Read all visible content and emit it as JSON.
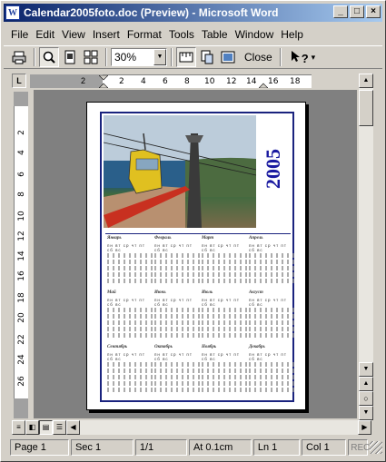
{
  "window": {
    "title": "Calendar2005foto.doc (Preview) - Microsoft Word",
    "app_icon": "W"
  },
  "title_buttons": {
    "minimize": "_",
    "maximize": "□",
    "close": "×"
  },
  "menu": [
    "File",
    "Edit",
    "View",
    "Insert",
    "Format",
    "Tools",
    "Table",
    "Window",
    "Help"
  ],
  "toolbar": {
    "zoom": "30%",
    "close_label": "Close",
    "help_label": "?"
  },
  "ruler": {
    "corner": "L",
    "h_ticks": [
      "2",
      "4",
      "6",
      "8",
      "10",
      "12",
      "14",
      "16",
      "18"
    ],
    "h_neg": "2",
    "v_ticks": [
      "2",
      "4",
      "6",
      "8",
      "10",
      "12",
      "14",
      "16",
      "18",
      "20",
      "22",
      "24",
      "26"
    ]
  },
  "document": {
    "year": "2005",
    "months": [
      "Январь",
      "Февраль",
      "Март",
      "Апрель",
      "Май",
      "Июнь",
      "Июль",
      "Август",
      "Сентябрь",
      "Октябрь",
      "Ноябрь",
      "Декабрь"
    ],
    "weekdays": "пн вт ср чт пт сб вс"
  },
  "status": {
    "page": "Page  1",
    "sec": "Sec  1",
    "pages": "1/1",
    "at": "At  0.1cm",
    "ln": "Ln  1",
    "col": "Col  1",
    "rec": "REC"
  }
}
